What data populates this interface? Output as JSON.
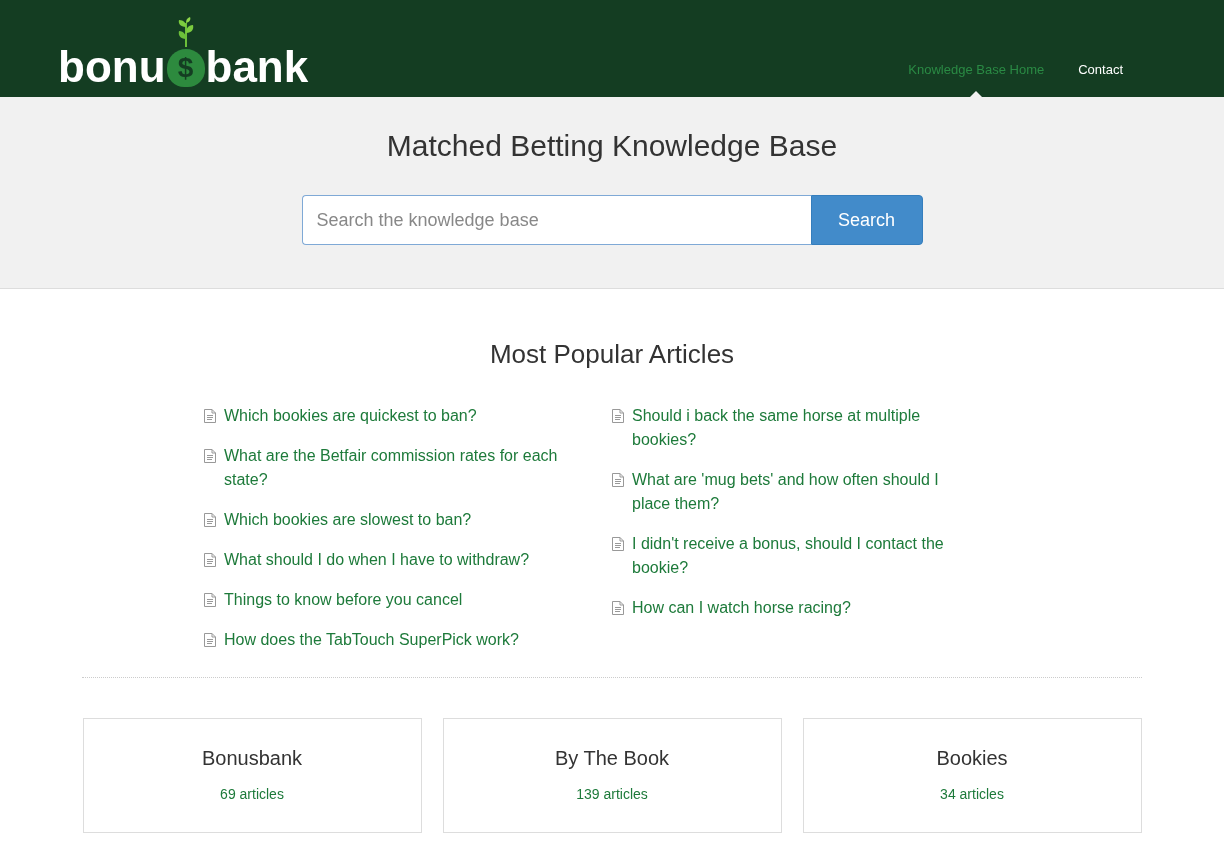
{
  "logo": {
    "before": "bonu",
    "bag_symbol": "$",
    "after": "bank"
  },
  "nav": [
    {
      "label": "Knowledge Base Home",
      "selected": true
    },
    {
      "label": "Contact",
      "selected": false
    }
  ],
  "hero": {
    "title": "Matched Betting Knowledge Base",
    "search": {
      "placeholder": "Search the knowledge base",
      "button": "Search"
    }
  },
  "popular": {
    "title": "Most Popular Articles",
    "columns": [
      [
        "Which bookies are quickest to ban?",
        "What are the Betfair commission rates for each state?",
        "Which bookies are slowest to ban?",
        "What should I do when I have to withdraw?",
        "Things to know before you cancel",
        "How does the TabTouch SuperPick work?"
      ],
      [
        "Should i back the same horse at multiple bookies?",
        "What are 'mug bets' and how often should I place them?",
        "I didn't receive a bonus, should I contact the bookie?",
        "How can I watch horse racing?"
      ]
    ]
  },
  "categories": [
    {
      "title": "Bonusbank",
      "count": "69 articles"
    },
    {
      "title": "By The Book",
      "count": "139 articles"
    },
    {
      "title": "Bookies",
      "count": "34 articles"
    }
  ]
}
